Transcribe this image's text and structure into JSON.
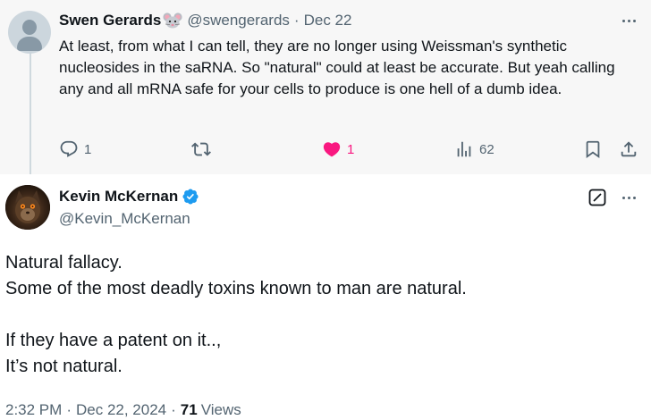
{
  "parent_tweet": {
    "author_name": "Swen Gerards",
    "author_emoji": "mouse",
    "handle": "@swengerards",
    "separator": "·",
    "date": "Dec 22",
    "text": "At least, from what I can tell, they are no longer using Weissman's synthetic nucleosides in the saRNA. So \"natural\" could at least be accurate. But yeah calling any and all mRNA safe for your cells to produce is one hell of a dumb idea.",
    "actions": {
      "reply_count": "1",
      "retweet_count": "",
      "like_count": "1",
      "view_count": "62"
    },
    "icons": [
      "default-avatar",
      "mouse-emoji-icon",
      "more-icon",
      "reply-icon",
      "retweet-icon",
      "like-icon",
      "views-icon",
      "bookmark-icon",
      "share-icon"
    ]
  },
  "main_tweet": {
    "author_name": "Kevin McKernan",
    "handle": "@Kevin_McKernan",
    "verified": true,
    "text_lines": [
      "Natural fallacy.",
      "Some of the most deadly toxins known to man are natural.",
      "",
      "If they have a patent on it..,",
      "It’s not natural."
    ],
    "time": "2:32 PM",
    "date": "Dec 22, 2024",
    "separator": "·",
    "views_count": "71",
    "views_label": "Views",
    "icons": [
      "avatar",
      "verified-badge-icon",
      "grok-icon",
      "more-icon"
    ]
  },
  "colors": {
    "text_primary": "#0f1419",
    "text_secondary": "#536471",
    "like_pink": "#f91880",
    "verified_blue": "#1d9bf0",
    "parent_background": "#f7f7f7",
    "thread_line": "#cfd9de"
  }
}
